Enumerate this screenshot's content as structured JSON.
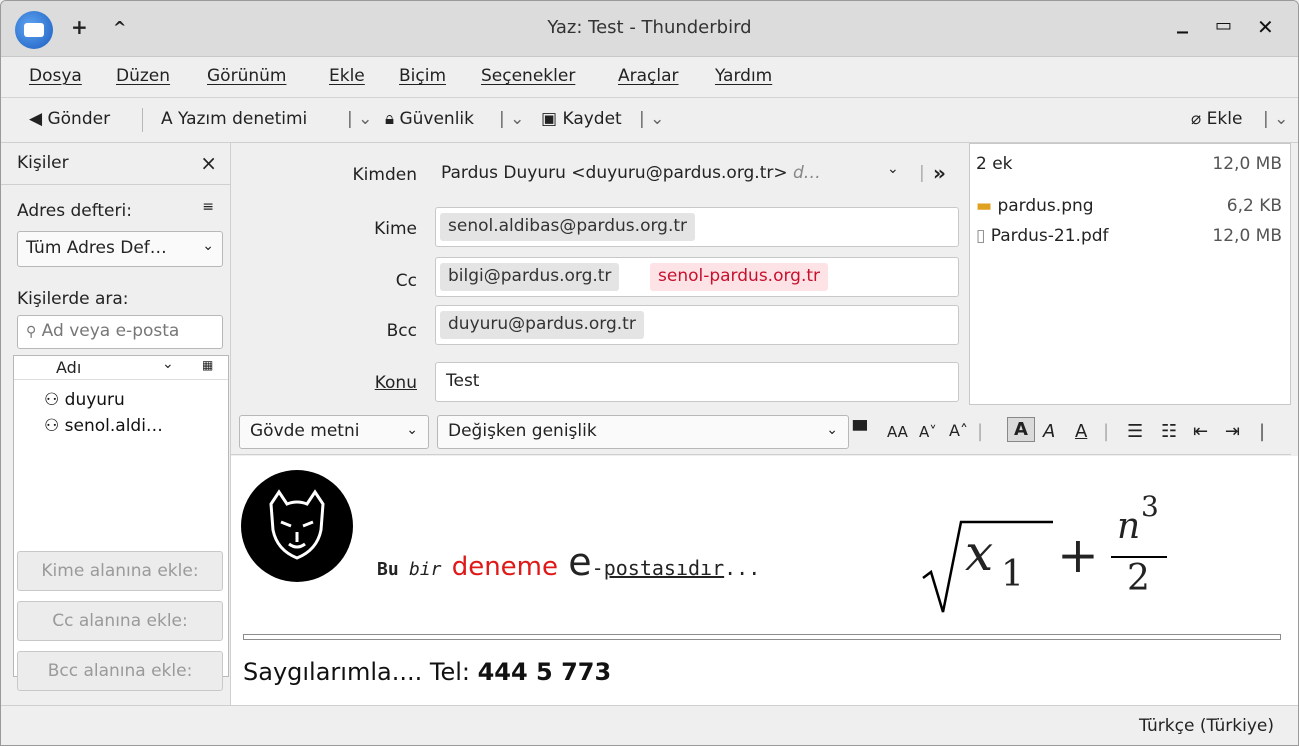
{
  "window": {
    "title": "Yaz: Test - Thunderbird",
    "add_symbol": "+",
    "collapse_symbol": "^",
    "min": "_",
    "max": "▭",
    "close": "✕"
  },
  "menu": [
    "Dosya",
    "Düzen",
    "Görünüm",
    "Ekle",
    "Biçim",
    "Seçenekler",
    "Araçlar",
    "Yardım"
  ],
  "toolbar": {
    "send": "Gönder",
    "spell": "Yazım denetimi",
    "security": "Güvenlik",
    "save": "Kaydet",
    "attach": "Ekle"
  },
  "contacts": {
    "title": "Kişiler",
    "addressbook_label": "Adres defteri:",
    "addressbook_value": "Tüm Adres Def…",
    "search_label": "Kişilerde ara:",
    "search_placeholder": "Ad veya e-posta",
    "column": "Adı",
    "items": [
      "duyuru",
      "senol.aldi…"
    ],
    "buttons": [
      "Kime alanına ekle:",
      "Cc alanına ekle:",
      "Bcc alanına ekle:"
    ]
  },
  "header": {
    "from_label": "Kimden",
    "from_value": "Pardus Duyuru <duyuru@pardus.org.tr>",
    "from_more": "d…",
    "to_label": "Kime",
    "to": [
      "senol.aldibas@pardus.org.tr"
    ],
    "cc_label": "Cc",
    "cc": [
      "bilgi@pardus.org.tr",
      "senol-pardus.org.tr"
    ],
    "bcc_label": "Bcc",
    "bcc": [
      "duyuru@pardus.org.tr"
    ],
    "subject_label": "Konu",
    "subject_value": "Test"
  },
  "attachments": {
    "count": "2 ek",
    "total": "12,0 MB",
    "files": [
      {
        "name": "pardus.png",
        "size": "6,2 KB"
      },
      {
        "name": "Pardus-21.pdf",
        "size": "12,0 MB"
      }
    ]
  },
  "format": {
    "paragraph": "Gövde metni",
    "font": "Değişken genişlik"
  },
  "body": {
    "w1": "Bu",
    "w2": "bir",
    "w3": "deneme",
    "w4": "e",
    "w5": "-",
    "w6": "postasıdır",
    "w7": "...",
    "math_x": "x",
    "math_sub": "1",
    "math_plus": "+",
    "math_n": "n",
    "math_exp": "3",
    "math_den": "2",
    "sig_text": "Saygılarımla.... Tel: ",
    "sig_phone": "444 5 773"
  },
  "status": {
    "language": "Türkçe (Türkiye)"
  },
  "colors": {
    "accent": "#1b5cbf",
    "error_pill": "#fde3e6",
    "red_text": "#e01818"
  }
}
